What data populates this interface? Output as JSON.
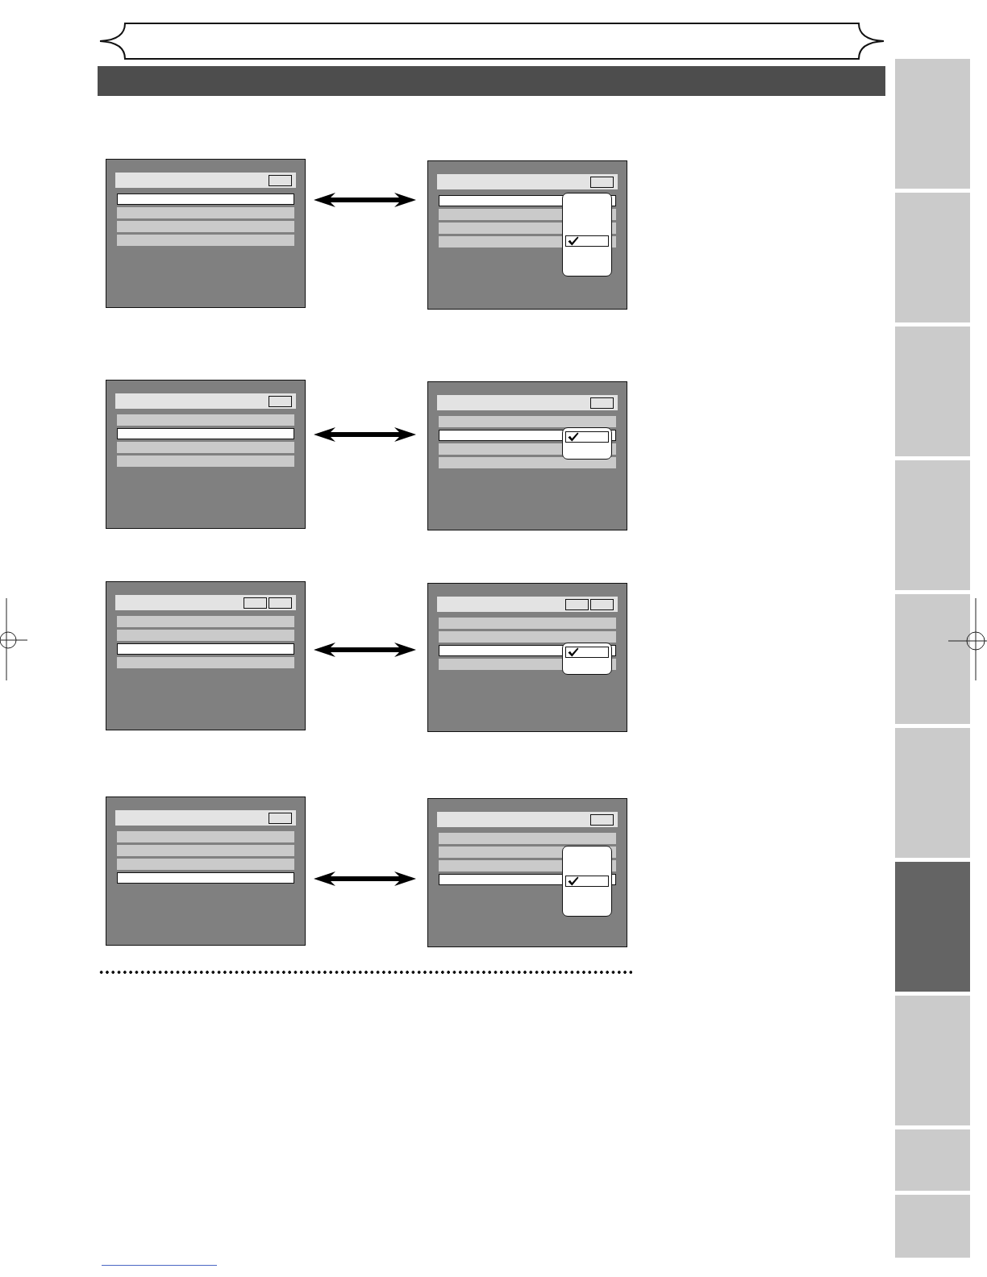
{
  "examples": [
    {
      "before": {
        "header_boxes": [
          {
            "kind": "tag"
          }
        ],
        "rows": [
          {
            "selected": true
          },
          {
            "selected": false
          },
          {
            "selected": false
          },
          {
            "selected": false
          }
        ]
      },
      "after": {
        "header_boxes": [
          {
            "kind": "tag"
          }
        ],
        "rows": [
          {
            "selected": true
          },
          {
            "selected": false
          },
          {
            "selected": false
          },
          {
            "selected": false
          }
        ],
        "dropdown": {
          "options": [
            {
              "checked": false
            },
            {
              "checked": false
            },
            {
              "checked": false
            },
            {
              "checked": true
            },
            {
              "checked": false
            },
            {
              "checked": false
            }
          ]
        }
      }
    },
    {
      "before": {
        "header_boxes": [
          {
            "kind": "tag"
          }
        ],
        "rows": [
          {
            "selected": false
          },
          {
            "selected": true
          },
          {
            "selected": false
          },
          {
            "selected": false
          }
        ]
      },
      "after": {
        "header_boxes": [
          {
            "kind": "tag"
          }
        ],
        "rows": [
          {
            "selected": false
          },
          {
            "selected": true
          },
          {
            "selected": false
          },
          {
            "selected": false
          }
        ],
        "dropdown": {
          "options": [
            {
              "checked": true
            },
            {
              "checked": false
            }
          ]
        }
      }
    },
    {
      "before": {
        "header_boxes": [
          {
            "kind": "tag"
          },
          {
            "kind": "tag"
          }
        ],
        "rows": [
          {
            "selected": false
          },
          {
            "selected": false
          },
          {
            "selected": true
          },
          {
            "selected": false
          }
        ]
      },
      "after": {
        "header_boxes": [
          {
            "kind": "tag"
          },
          {
            "kind": "tag"
          }
        ],
        "rows": [
          {
            "selected": false
          },
          {
            "selected": false
          },
          {
            "selected": true
          },
          {
            "selected": false
          }
        ],
        "dropdown": {
          "options": [
            {
              "checked": true
            },
            {
              "checked": false
            }
          ]
        }
      }
    },
    {
      "before": {
        "header_boxes": [
          {
            "kind": "tag"
          }
        ],
        "rows": [
          {
            "selected": false
          },
          {
            "selected": false
          },
          {
            "selected": false
          },
          {
            "selected": true
          }
        ]
      },
      "after": {
        "header_boxes": [
          {
            "kind": "tag"
          }
        ],
        "rows": [
          {
            "selected": false
          },
          {
            "selected": false
          },
          {
            "selected": false
          },
          {
            "selected": true
          }
        ],
        "dropdown": {
          "options": [
            {
              "checked": false
            },
            {
              "checked": false
            },
            {
              "checked": true
            },
            {
              "checked": false
            },
            {
              "checked": false
            }
          ]
        }
      }
    }
  ],
  "side_tabs": [
    {
      "selected": false
    },
    {
      "selected": false
    },
    {
      "selected": false
    },
    {
      "selected": false
    },
    {
      "selected": false
    },
    {
      "selected": false
    },
    {
      "selected": true
    },
    {
      "selected": false
    },
    {
      "selected": false
    },
    {
      "selected": false
    }
  ]
}
